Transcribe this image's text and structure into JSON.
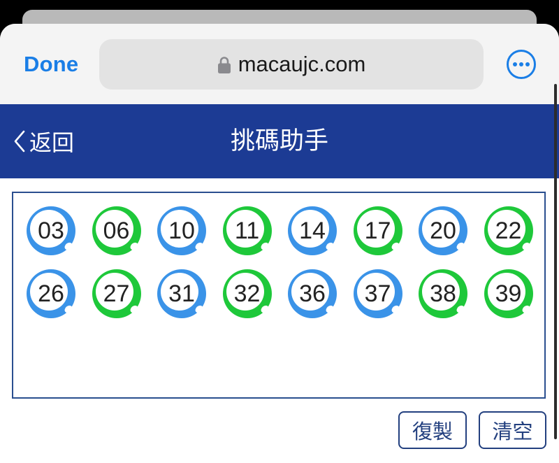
{
  "browser": {
    "done_label": "Done",
    "url": "macaujc.com",
    "lock_icon": "lock-icon",
    "more_icon": "more-options-icon",
    "accent_color": "#1a7ee6"
  },
  "header": {
    "back_label": "返回",
    "title": "挑碼助手",
    "background_color": "#1c3b94"
  },
  "selected_numbers": [
    {
      "number": "03",
      "color": "blue"
    },
    {
      "number": "06",
      "color": "green"
    },
    {
      "number": "10",
      "color": "blue"
    },
    {
      "number": "11",
      "color": "green"
    },
    {
      "number": "14",
      "color": "blue"
    },
    {
      "number": "17",
      "color": "green"
    },
    {
      "number": "20",
      "color": "blue"
    },
    {
      "number": "22",
      "color": "green"
    },
    {
      "number": "26",
      "color": "blue"
    },
    {
      "number": "27",
      "color": "green"
    },
    {
      "number": "31",
      "color": "blue"
    },
    {
      "number": "32",
      "color": "green"
    },
    {
      "number": "36",
      "color": "blue"
    },
    {
      "number": "37",
      "color": "blue"
    },
    {
      "number": "38",
      "color": "green"
    },
    {
      "number": "39",
      "color": "green"
    }
  ],
  "ball_colors": {
    "blue": "#3a93e8",
    "green": "#1ec83a"
  },
  "actions": {
    "copy_label": "復製",
    "clear_label": "清空"
  }
}
